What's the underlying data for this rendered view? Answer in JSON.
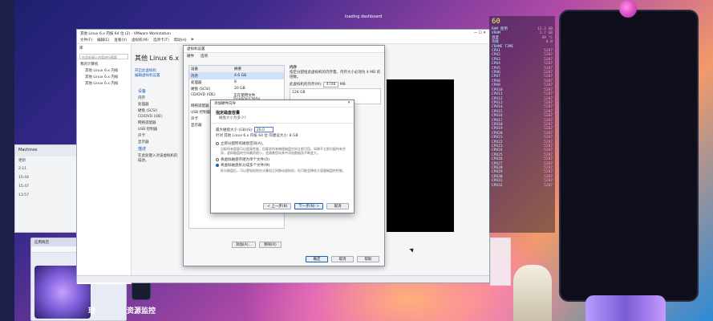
{
  "desktop": {
    "top_right_text": "loading dashboard",
    "left_labels": [
      "Machines",
      "更新",
      "2:11",
      "15:44",
      "15:47",
      "13:57"
    ],
    "bottom_labels": {
      "apps_left": "理",
      "monitor": "资源监控"
    },
    "apps_window_tab": "应用商店"
  },
  "vmware": {
    "title": "其他 Linux 6.x 内核 64 位 (2) - VMware Workstation",
    "menu": [
      "文件(F)",
      "编辑(E)",
      "查看(V)",
      "虚拟机(M)",
      "选项卡(T)",
      "帮助(H)"
    ],
    "library_header": "库",
    "search_placeholder": "在此处键入内容进行搜索",
    "tree": [
      "我的计算机",
      "其他 Linux 6.x 内核",
      "其他 Linux 6.x 内核",
      "其他 Linux 6.x 内核"
    ],
    "vm_name": "其他 Linux 6.x",
    "actions": [
      "开启此虚拟机",
      "编辑虚拟机设置"
    ],
    "devices_header": "设备",
    "devices": [
      "内存",
      "处理器",
      "硬盘 (SCSI)",
      "CD/DVD (IDE)",
      "网络适配器",
      "USB 控制器",
      "声卡",
      "显示器"
    ],
    "desc_header": "描述",
    "desc_text": "在此处键入对该虚拟机的描述。"
  },
  "settings": {
    "title": "虚拟机设置",
    "tabs": [
      "硬件",
      "选项"
    ],
    "col_device": "设备",
    "col_summary": "摘要",
    "rows": [
      {
        "device": "内存",
        "summary": "4.6 GB"
      },
      {
        "device": "处理器",
        "summary": "8"
      },
      {
        "device": "硬盘 (SCSI)",
        "summary": "20 GB"
      },
      {
        "device": "CD/DVD (IDE)",
        "summary": "正在使用文件 D:\\\\ISO\\\\1765\\\\"
      },
      {
        "device": "网络适配器",
        "summary": "桥接模式"
      },
      {
        "device": "USB 控制器",
        "summary": "存在"
      },
      {
        "device": "声卡",
        "summary": "自动检测"
      },
      {
        "device": "显示器",
        "summary": "自动检测"
      }
    ],
    "memory_header": "内存",
    "memory_desc": "指定分配给此虚拟机的内存量。内存大小必须为 4 MB 的倍数。",
    "memory_label": "此虚拟机的内存(M):",
    "memory_value": "4708",
    "memory_unit": "MB",
    "memory_scale_top": "128 GB",
    "add_button": "添加(A)...",
    "remove_button": "移除(R)",
    "ok_button": "确定",
    "cancel_button": "取消",
    "help_button": "帮助",
    "right_note": "最大推荐虚拟机内存"
  },
  "wizard": {
    "title": "添加硬件向导",
    "heading": "指定磁盘容量",
    "subheading": "磁盘大小为多少?",
    "max_size_label": "最大磁盘大小 (GB)(S):",
    "max_size_value": "20.0",
    "recommended": "针对 其他 Linux 6.x 内核 64 位 的建议大小: 8 GB",
    "alloc_now": "立即分配所有磁盘空间(A)。",
    "alloc_desc": "分配所有容量可以提高性能，但要求所有物理磁盘空间立即可用。如果不立即分配所有空间，虚拟磁盘的空间最初很小，会随着您向其中添加数据而不断变大。",
    "single_file": "将虚拟磁盘存储为单个文件(O)",
    "split_file": "将虚拟磁盘拆分成多个文件(M)",
    "split_desc": "拆分磁盘后，可以更轻松地在计算机之间移动虚拟机，但可能会降低大容量磁盘的性能。",
    "back_button": "< 上一步(B)",
    "next_button": "下一步(N) >",
    "cancel_button": "取消"
  },
  "hud": {
    "fps": "60",
    "lines": [
      {
        "k": "RAM 使用",
        "v": "12.3 GB"
      },
      {
        "k": "VRAM",
        "v": "2.7 GB"
      },
      {
        "k": "温度",
        "v": "49 °C"
      },
      {
        "k": "功耗",
        "v": "8 W"
      },
      {
        "k": "FRAME TIME",
        "v": ""
      },
      {
        "k": "CPU1",
        "v": "5287"
      },
      {
        "k": "CPU2",
        "v": "5287"
      },
      {
        "k": "CPU3",
        "v": "5287"
      },
      {
        "k": "CPU4",
        "v": "5287"
      },
      {
        "k": "CPU5",
        "v": "5287"
      },
      {
        "k": "CPU6",
        "v": "5287"
      },
      {
        "k": "CPU7",
        "v": "5287"
      },
      {
        "k": "CPU8",
        "v": "5287"
      },
      {
        "k": "CPU9",
        "v": "5287"
      },
      {
        "k": "CPU10",
        "v": "5287"
      },
      {
        "k": "CPU11",
        "v": "5287"
      },
      {
        "k": "CPU12",
        "v": "5287"
      },
      {
        "k": "CPU13",
        "v": "5287"
      },
      {
        "k": "CPU14",
        "v": "5287"
      },
      {
        "k": "CPU15",
        "v": "5287"
      },
      {
        "k": "CPU16",
        "v": "5287"
      },
      {
        "k": "CPU17",
        "v": "5287"
      },
      {
        "k": "CPU18",
        "v": "5287"
      },
      {
        "k": "CPU19",
        "v": "5287"
      },
      {
        "k": "CPU20",
        "v": "5287"
      },
      {
        "k": "CPU21",
        "v": "5287"
      },
      {
        "k": "CPU22",
        "v": "5287"
      },
      {
        "k": "CPU23",
        "v": "5287"
      },
      {
        "k": "CPU24",
        "v": "5287"
      },
      {
        "k": "CPU25",
        "v": "5287"
      },
      {
        "k": "CPU26",
        "v": "5287"
      },
      {
        "k": "CPU27",
        "v": "5287"
      },
      {
        "k": "CPU28",
        "v": "5287"
      },
      {
        "k": "CPU29",
        "v": "5287"
      },
      {
        "k": "CPU30",
        "v": "5287"
      },
      {
        "k": "CPU31",
        "v": "5287"
      },
      {
        "k": "CPU32",
        "v": "5287"
      }
    ]
  }
}
